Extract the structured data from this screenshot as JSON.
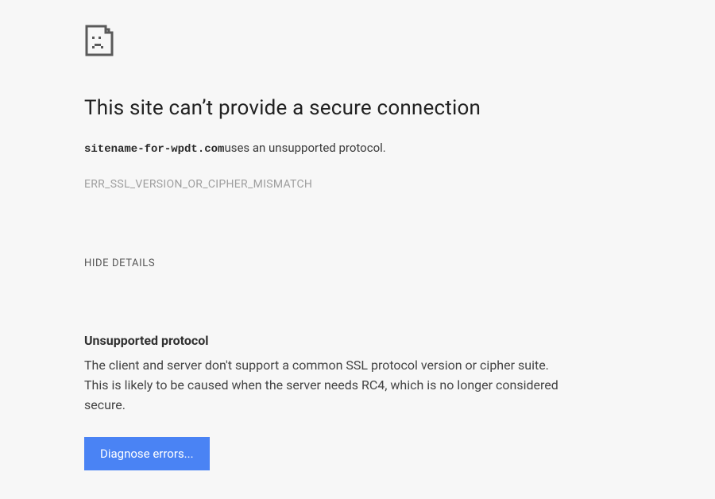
{
  "headline": "This site can’t provide a secure connection",
  "site_name": "sitename-for-wpdt.com",
  "desc_suffix": "uses an unsupported protocol.",
  "error_code": "ERR_SSL_VERSION_OR_CIPHER_MISMATCH",
  "toggle_label": "HIDE DETAILS",
  "details": {
    "title": "Unsupported protocol",
    "body": "The client and server don't support a common SSL protocol version or cipher suite. This is likely to be caused when the server needs RC4, which is no longer considered secure."
  },
  "diagnose_label": "Diagnose errors..."
}
